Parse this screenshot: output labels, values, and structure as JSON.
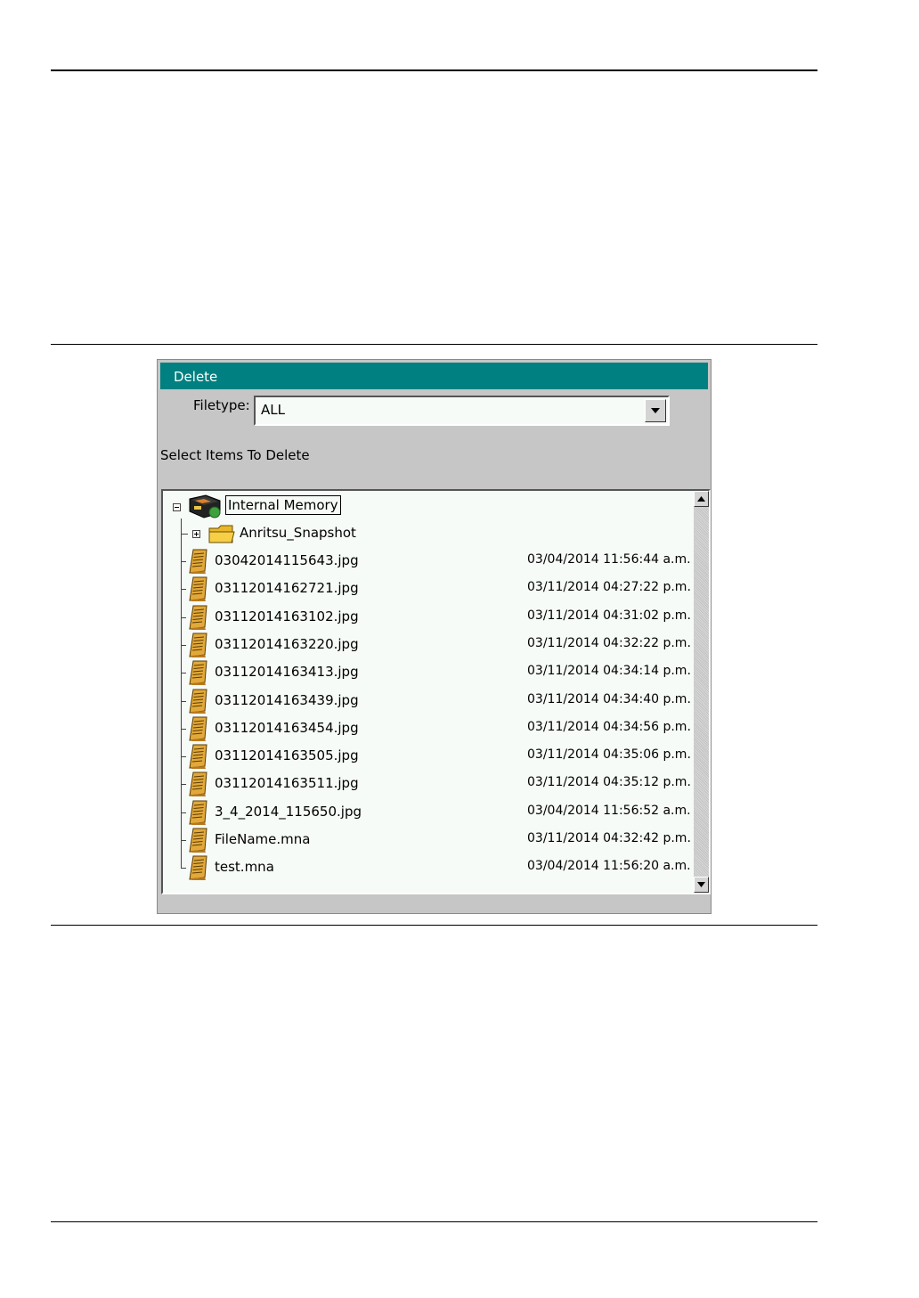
{
  "dialog": {
    "title": "Delete",
    "filetype_label": "Filetype:",
    "filetype_value": "ALL",
    "instruction": "Select Items To Delete"
  },
  "tree": {
    "root": "Internal Memory",
    "folder": "Anritsu_Snapshot",
    "files": [
      {
        "name": "03042014115643.jpg",
        "date": "03/04/2014 11:56:44 a.m."
      },
      {
        "name": "03112014162721.jpg",
        "date": "03/11/2014 04:27:22 p.m."
      },
      {
        "name": "03112014163102.jpg",
        "date": "03/11/2014 04:31:02 p.m."
      },
      {
        "name": "03112014163220.jpg",
        "date": "03/11/2014 04:32:22 p.m."
      },
      {
        "name": "03112014163413.jpg",
        "date": "03/11/2014 04:34:14 p.m."
      },
      {
        "name": "03112014163439.jpg",
        "date": "03/11/2014 04:34:40 p.m."
      },
      {
        "name": "03112014163454.jpg",
        "date": "03/11/2014 04:34:56 p.m."
      },
      {
        "name": "03112014163505.jpg",
        "date": "03/11/2014 04:35:06 p.m."
      },
      {
        "name": "03112014163511.jpg",
        "date": "03/11/2014 04:35:12 p.m."
      },
      {
        "name": "3_4_2014_115650.jpg",
        "date": "03/04/2014 11:56:52 a.m."
      },
      {
        "name": "FileName.mna",
        "date": "03/11/2014 04:32:42 p.m."
      },
      {
        "name": "test.mna",
        "date": "03/04/2014 11:56:20 a.m."
      }
    ]
  },
  "colors": {
    "titlebar": "#008080",
    "dialog_bg": "#c6c6c6",
    "tree_bg": "#f7fbf7"
  },
  "icons": {
    "root": "memory-drive-icon",
    "folder": "folder-icon",
    "file": "document-icon"
  }
}
